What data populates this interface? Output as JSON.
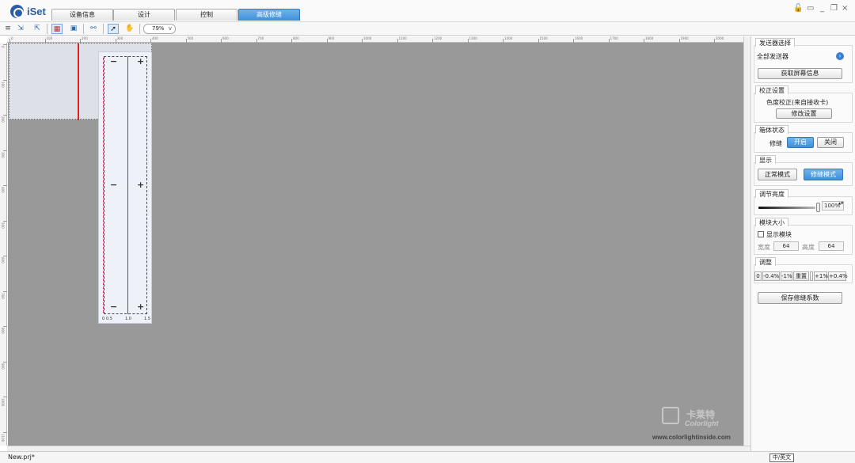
{
  "app": {
    "name": "iSet"
  },
  "tabs": [
    {
      "label": "设备信息",
      "active": false
    },
    {
      "label": "设计",
      "active": false
    },
    {
      "label": "控制",
      "active": false
    },
    {
      "label": "高级修缝",
      "active": true
    }
  ],
  "window_controls": [
    "lock-icon",
    "monitor-icon",
    "minimize-icon",
    "restore-icon",
    "close-icon"
  ],
  "window_control_glyphs": [
    "🔓",
    "▭",
    "_",
    "❐",
    "×"
  ],
  "toolbar": {
    "zoom_value": "79%",
    "zoom_arrow": "v",
    "icons": [
      "menu-icon",
      "import-icon",
      "export-icon",
      "grid-icon",
      "layout-icon",
      "link-icon",
      "pointer-icon",
      "hand-icon"
    ],
    "glyphs": [
      "≡",
      "⇲",
      "⇱",
      "▦",
      "▣",
      "⚯",
      "➚",
      "✋"
    ]
  },
  "ruler": {
    "h_labels": [
      "0",
      "100",
      "200",
      "300",
      "400",
      "500",
      "600",
      "700",
      "800",
      "900",
      "1000",
      "1100",
      "1200",
      "1300",
      "1400",
      "1500",
      "1600",
      "1700",
      "1800",
      "1900",
      "2000"
    ],
    "v_labels": [
      "0",
      "100",
      "200",
      "300",
      "400",
      "500",
      "600",
      "700",
      "800",
      "900",
      "1000",
      "1100"
    ]
  },
  "popup": {
    "minus": "−",
    "plus": "+",
    "scale": [
      "0",
      "0.5",
      "1.0",
      "1.5"
    ]
  },
  "right_panel": {
    "sender": {
      "title": "发送器选择",
      "value": "全部发送器",
      "arrow": "›",
      "get_screen_info": "获取屏幕信息"
    },
    "calibration": {
      "title": "校正设置",
      "status": "色度校正(来自接收卡)",
      "modify": "修改设置"
    },
    "cabinet": {
      "title": "箱体状态",
      "label": "修缝",
      "on": "开启",
      "off": "关闭"
    },
    "display": {
      "title": "显示",
      "normal_mode": "正常模式",
      "seam_mode": "修缝模式"
    },
    "brightness": {
      "title": "调节亮度",
      "value": "100%",
      "spin": "▲▼"
    },
    "module": {
      "title": "模块大小",
      "show_module": "显示模块",
      "width_label": "宽度",
      "width": "64",
      "height_label": "高度",
      "height": "64"
    },
    "adjust": {
      "title": "调整",
      "buttons": [
        "0",
        "-0.4%",
        "-1%",
        "重置",
        "+1%",
        "+0.4%"
      ]
    },
    "save": "保存修缝系数"
  },
  "watermark": {
    "cn": "卡莱特",
    "en": "Colorlight",
    "url": "www.colorlightinside.com"
  },
  "status": {
    "file": "New.prj*"
  },
  "tooltip": "中/英文"
}
